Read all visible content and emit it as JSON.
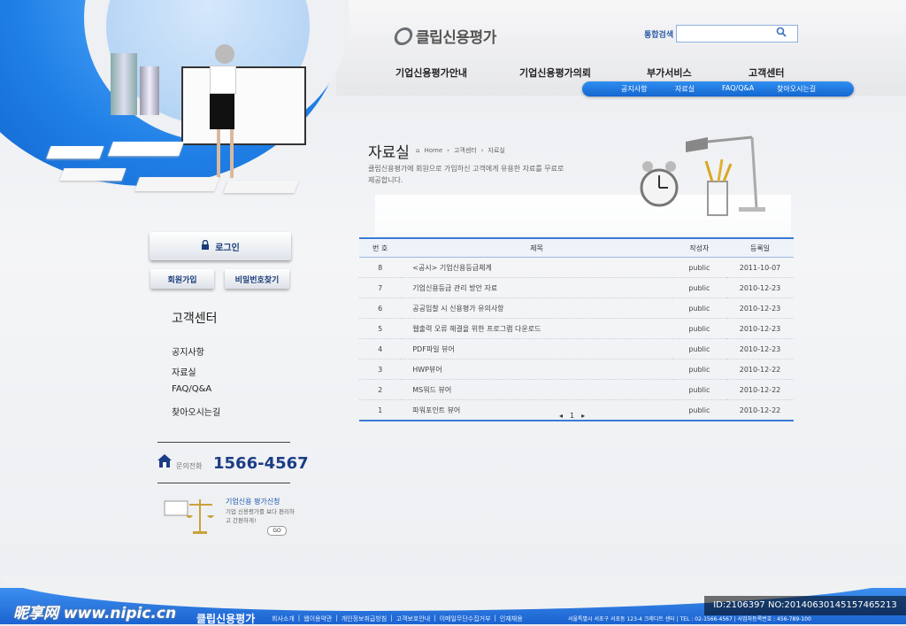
{
  "header": {
    "logo_text": "클립신용평가",
    "search_label": "통합검색",
    "search_placeholder": "",
    "main_nav": [
      "기업신용평가안내",
      "기업신용평가의뢰",
      "부가서비스",
      "고객센터"
    ],
    "sub_nav": [
      "공지사항",
      "자료실",
      "FAQ/Q&A",
      "찾아오시는길"
    ]
  },
  "page": {
    "title": "자료실",
    "breadcrumb": [
      "Home",
      "고객센터",
      "자료실"
    ],
    "description": "클립신용평가에 회원으로 가입하신 고객에게 유용한 자료를 무료로 제공합니다."
  },
  "board": {
    "columns": [
      "번 호",
      "제목",
      "작성자",
      "등록일"
    ],
    "rows": [
      {
        "no": "8",
        "title": "<공시> 기업신용등급체계",
        "author": "public",
        "date": "2011-10-07"
      },
      {
        "no": "7",
        "title": "기업신용등급 관리 방안 자료",
        "author": "public",
        "date": "2010-12-23"
      },
      {
        "no": "6",
        "title": "공공입찰 시 신용평가 유의사항",
        "author": "public",
        "date": "2010-12-23"
      },
      {
        "no": "5",
        "title": "웹출력 오류 해결을 위한 프로그램 다운로드",
        "author": "public",
        "date": "2010-12-23"
      },
      {
        "no": "4",
        "title": "PDF파일 뷰어",
        "author": "public",
        "date": "2010-12-23"
      },
      {
        "no": "3",
        "title": "HWP뷰어",
        "author": "public",
        "date": "2010-12-22"
      },
      {
        "no": "2",
        "title": "MS워드 뷰어",
        "author": "public",
        "date": "2010-12-22"
      },
      {
        "no": "1",
        "title": "파워포인트 뷰어",
        "author": "public",
        "date": "2010-12-22"
      }
    ],
    "pager": {
      "prev": "◂",
      "current": "1",
      "next": "▸"
    }
  },
  "sidebar": {
    "login_label": "로그인",
    "join_label": "회원가입",
    "find_pw_label": "비밀번호찾기",
    "section_title": "고객센터",
    "items": [
      "공지사항",
      "자료실",
      "FAQ/Q&A",
      "찾아오시는길"
    ],
    "phone_label": "문의전화",
    "phone_number": "1566-4567",
    "apply_title": "기업신용 평가신청",
    "apply_desc": "기업 신용평가를 보다 편리하고 간편하게!",
    "go_label": "GO"
  },
  "footer": {
    "logo_text": "클립신용평가",
    "links": [
      "회사소개",
      "|",
      "웹이용약관",
      "|",
      "개인정보취급방침",
      "|",
      "고객보호안내",
      "|",
      "이메일무단수집거부",
      "|",
      "인재채용"
    ],
    "address": "서울특별시 서초구 서초동 123-4 크레디트 센터 | TEL : 02-1566-4567 | 사업자등록번호 : 456-789-100"
  },
  "watermarks": {
    "left": "昵享网 www.nipic.cn",
    "right": "ID:2106397 NO:20140630145157465213"
  },
  "colors": {
    "accent": "#1b6fe0",
    "nav_blue": "#1466d0",
    "dark_navy": "#1b3d86"
  }
}
